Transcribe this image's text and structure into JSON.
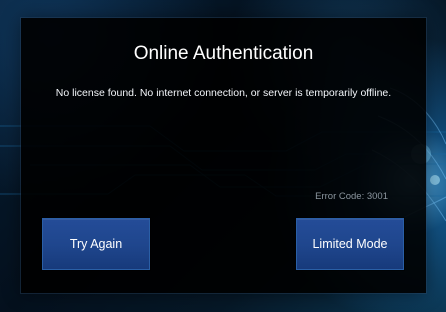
{
  "dialog": {
    "title": "Online Authentication",
    "message": "No license found.  No internet connection, or server is temporarily offline.",
    "error_code": "Error Code: 3001"
  },
  "buttons": {
    "try_again": "Try Again",
    "limited_mode": "Limited Mode"
  },
  "colors": {
    "dialog_background": "#000000",
    "button_blue": "#1f468d",
    "button_border": "#2a5fa6",
    "error_text": "#8c969f"
  }
}
